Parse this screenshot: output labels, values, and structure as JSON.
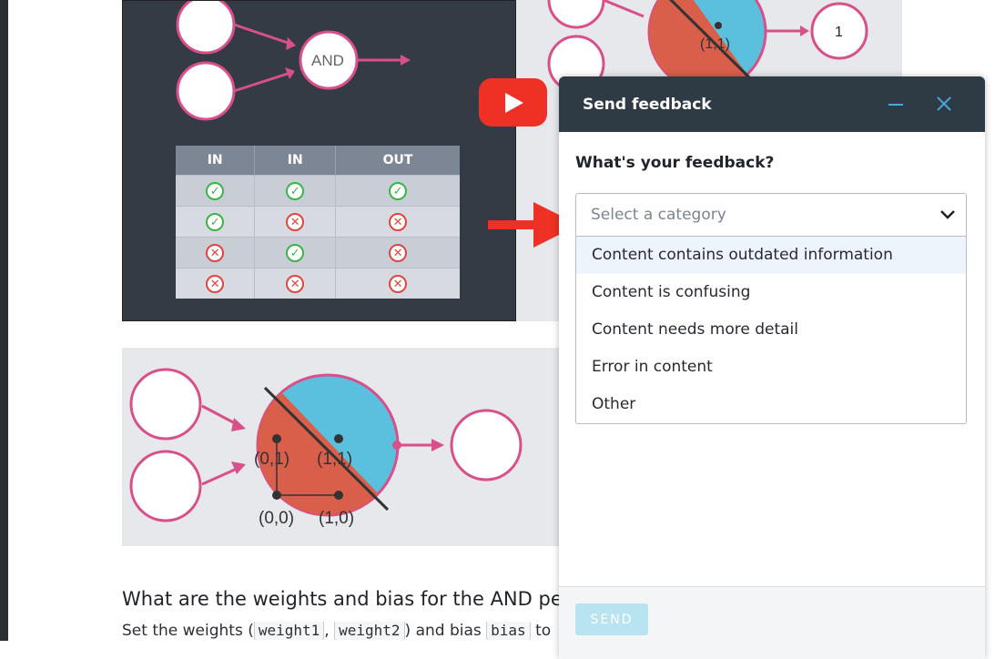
{
  "lesson": {
    "and_label": "AND",
    "output_label": "1",
    "point_top_label": "(1,1)",
    "table_headers": [
      "IN",
      "IN",
      "OUT"
    ],
    "table_rows": [
      [
        "ok",
        "ok",
        "ok"
      ],
      [
        "ok",
        "no",
        "no"
      ],
      [
        "no",
        "ok",
        "no"
      ],
      [
        "no",
        "no",
        "no"
      ]
    ],
    "points": {
      "p01": "(0,1)",
      "p11": "(1,1)",
      "p00": "(0,0)",
      "p10": "(1,0)"
    },
    "heading": "What are the weights and bias for the AND pe",
    "body_prefix": "Set the weights (",
    "code1": "weight1",
    "sep1": ", ",
    "code2": "weight2",
    "mid": ") and bias ",
    "code3": "bias",
    "body_suffix": " to"
  },
  "feedback_dialog": {
    "title": "Send feedback",
    "question": "What's your feedback?",
    "select_placeholder": "Select a category",
    "options": [
      "Content contains outdated information",
      "Content is confusing",
      "Content needs more detail",
      "Error in content",
      "Other"
    ],
    "send_label": "SEND"
  },
  "colors": {
    "accent": "#4aa7e0",
    "header": "#2f3b44",
    "arrow_red": "#ee3124",
    "neuron_pink": "#d94f8a",
    "region_red": "#d95f4a",
    "region_blue": "#5bc0de"
  }
}
